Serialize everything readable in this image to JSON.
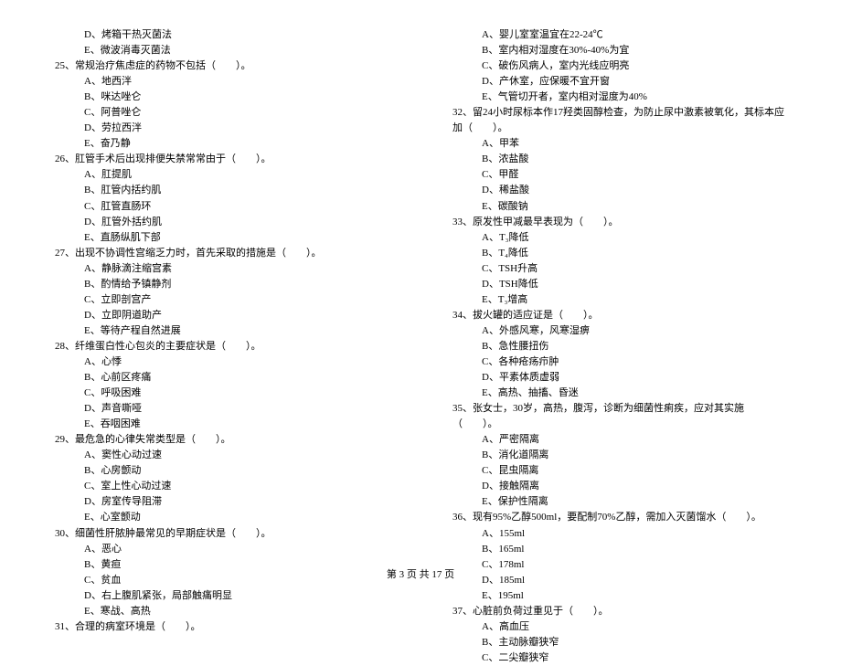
{
  "left_column": [
    {
      "type": "option",
      "text": "D、烤箱干热灭菌法"
    },
    {
      "type": "option",
      "text": "E、微波消毒灭菌法"
    },
    {
      "type": "question",
      "text": "25、常规治疗焦虑症的药物不包括（　　）。"
    },
    {
      "type": "option",
      "text": "A、地西泮"
    },
    {
      "type": "option",
      "text": "B、咪达唑仑"
    },
    {
      "type": "option",
      "text": "C、阿普唑仑"
    },
    {
      "type": "option",
      "text": "D、劳拉西泮"
    },
    {
      "type": "option",
      "text": "E、奋乃静"
    },
    {
      "type": "question",
      "text": "26、肛管手术后出现排便失禁常常由于（　　）。"
    },
    {
      "type": "option",
      "text": "A、肛提肌"
    },
    {
      "type": "option",
      "text": "B、肛管内括约肌"
    },
    {
      "type": "option",
      "text": "C、肛管直肠环"
    },
    {
      "type": "option",
      "text": "D、肛管外括约肌"
    },
    {
      "type": "option",
      "text": "E、直肠纵肌下部"
    },
    {
      "type": "question",
      "text": "27、出现不协调性宫缩乏力时，首先采取的措施是（　　）。"
    },
    {
      "type": "option",
      "text": "A、静脉滴注缩宫素"
    },
    {
      "type": "option",
      "text": "B、酌情给予镇静剂"
    },
    {
      "type": "option",
      "text": "C、立即剖宫产"
    },
    {
      "type": "option",
      "text": "D、立即阴道助产"
    },
    {
      "type": "option",
      "text": "E、等待产程自然进展"
    },
    {
      "type": "question",
      "text": "28、纤维蛋白性心包炎的主要症状是（　　）。"
    },
    {
      "type": "option",
      "text": "A、心悸"
    },
    {
      "type": "option",
      "text": "B、心前区疼痛"
    },
    {
      "type": "option",
      "text": "C、呼吸困难"
    },
    {
      "type": "option",
      "text": "D、声音嘶哑"
    },
    {
      "type": "option",
      "text": "E、吞咽困难"
    },
    {
      "type": "question",
      "text": "29、最危急的心律失常类型是（　　）。"
    },
    {
      "type": "option",
      "text": "A、窦性心动过速"
    },
    {
      "type": "option",
      "text": "B、心房颤动"
    },
    {
      "type": "option",
      "text": "C、室上性心动过速"
    },
    {
      "type": "option",
      "text": "D、房室传导阻滞"
    },
    {
      "type": "option",
      "text": "E、心室颤动"
    },
    {
      "type": "question",
      "text": "30、细菌性肝脓肿最常见的早期症状是（　　）。"
    },
    {
      "type": "option",
      "text": "A、恶心"
    },
    {
      "type": "option",
      "text": "B、黄疸"
    },
    {
      "type": "option",
      "text": "C、贫血"
    },
    {
      "type": "option",
      "text": "D、右上腹肌紧张，局部触痛明显"
    },
    {
      "type": "option",
      "text": "E、寒战、高热"
    },
    {
      "type": "question",
      "text": "31、合理的病室环境是（　　）。"
    }
  ],
  "right_column": [
    {
      "type": "option",
      "text": "A、婴儿室室温宜在22-24℃"
    },
    {
      "type": "option",
      "text": "B、室内相对湿度在30%-40%为宜"
    },
    {
      "type": "option",
      "text": "C、破伤风病人，室内光线应明亮"
    },
    {
      "type": "option",
      "text": "D、产休室，应保暖不宜开窗"
    },
    {
      "type": "option",
      "text": "E、气管切开者，室内相对湿度为40%"
    },
    {
      "type": "question",
      "text": "32、留24小时尿标本作17羟类固醇检查，为防止尿中激素被氧化，其标本应加（　　）。"
    },
    {
      "type": "option",
      "text": "A、甲苯"
    },
    {
      "type": "option",
      "text": "B、浓盐酸"
    },
    {
      "type": "option",
      "text": "C、甲醛"
    },
    {
      "type": "option",
      "text": "D、稀盐酸"
    },
    {
      "type": "option",
      "text": "E、碳酸钠"
    },
    {
      "type": "question",
      "text": "33、原发性甲减最早表现为（　　）。"
    },
    {
      "type": "option",
      "text": "A、T₃降低"
    },
    {
      "type": "option",
      "text": "B、T₄降低"
    },
    {
      "type": "option",
      "text": "C、TSH升高"
    },
    {
      "type": "option",
      "text": "D、TSH降低"
    },
    {
      "type": "option",
      "text": "E、T₃增高"
    },
    {
      "type": "question",
      "text": "34、拔火罐的适应证是（　　）。"
    },
    {
      "type": "option",
      "text": "A、外感风寒，风寒湿痹"
    },
    {
      "type": "option",
      "text": "B、急性腰扭伤"
    },
    {
      "type": "option",
      "text": "C、各种疮疡疖肿"
    },
    {
      "type": "option",
      "text": "D、平素体质虚弱"
    },
    {
      "type": "option",
      "text": "E、高热、抽搐、昏迷"
    },
    {
      "type": "question",
      "text": "35、张女士，30岁，高热，腹泻，诊断为细菌性痢疾，应对其实施（　　）。"
    },
    {
      "type": "option",
      "text": "A、严密隔离"
    },
    {
      "type": "option",
      "text": "B、消化道隔离"
    },
    {
      "type": "option",
      "text": "C、昆虫隔离"
    },
    {
      "type": "option",
      "text": "D、接触隔离"
    },
    {
      "type": "option",
      "text": "E、保护性隔离"
    },
    {
      "type": "question",
      "text": "36、现有95%乙醇500ml，要配制70%乙醇，需加入灭菌馏水（　　）。"
    },
    {
      "type": "option",
      "text": "A、155ml"
    },
    {
      "type": "option",
      "text": "B、165ml"
    },
    {
      "type": "option",
      "text": "C、178ml"
    },
    {
      "type": "option",
      "text": "D、185ml"
    },
    {
      "type": "option",
      "text": "E、195ml"
    },
    {
      "type": "question",
      "text": "37、心脏前负荷过重见于（　　）。"
    },
    {
      "type": "option",
      "text": "A、高血压"
    },
    {
      "type": "option",
      "text": "B、主动脉瓣狭窄"
    },
    {
      "type": "option",
      "text": "C、二尖瓣狭窄"
    }
  ],
  "footer": "第 3 页 共 17 页"
}
